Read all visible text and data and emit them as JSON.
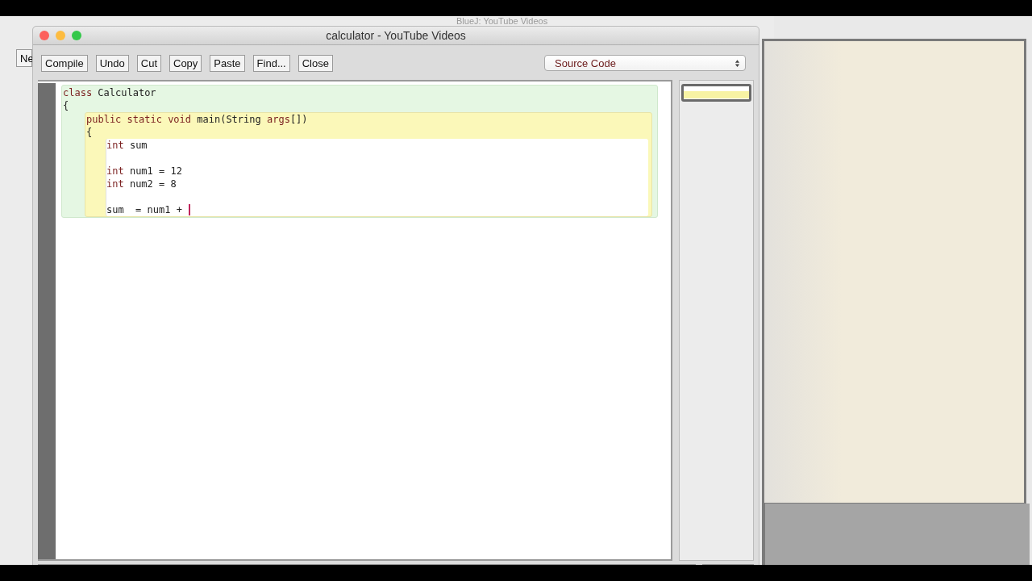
{
  "background_window": {
    "title": "BlueJ: YouTube Videos",
    "button": "Ne"
  },
  "window": {
    "title": "calculator - YouTube Videos"
  },
  "toolbar": {
    "buttons": [
      "Compile",
      "Undo",
      "Cut",
      "Copy",
      "Paste",
      "Find...",
      "Close"
    ],
    "view_selector": "Source Code"
  },
  "code": {
    "class_header": [
      [
        {
          "kw": "class"
        },
        " Calculator"
      ]
    ],
    "class_open": [
      [
        "{"
      ]
    ],
    "method_header": [
      [
        {
          "kw": "public static void"
        },
        " main(String ",
        {
          "kw": "args"
        },
        "[])"
      ]
    ],
    "method_open": [
      [
        "{"
      ]
    ],
    "body": [
      {
        "tokens": [
          {
            "kw": "int"
          },
          " sum"
        ]
      },
      {
        "gap_before": true,
        "tokens": [
          {
            "kw": "int"
          },
          " num1 = 12"
        ]
      },
      {
        "tokens": [
          {
            "kw": "int"
          },
          " num2 = 8"
        ]
      },
      {
        "gap_before": true,
        "tokens": [
          "sum  = num1 + "
        ]
      }
    ]
  }
}
